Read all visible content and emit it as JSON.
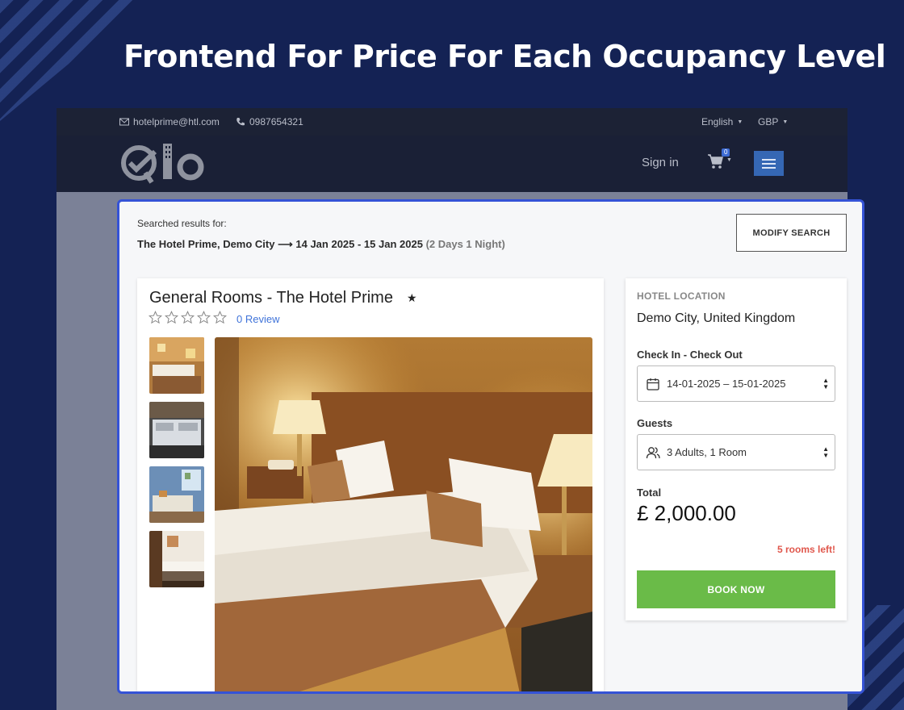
{
  "headline": "Frontend For Price For Each Occupancy Level",
  "topbar": {
    "email": "hotelprime@htl.com",
    "phone": "0987654321",
    "language": "English",
    "currency": "GBP"
  },
  "navbar": {
    "logo_text": "Qlo",
    "signin": "Sign in",
    "cart_count": "0"
  },
  "search": {
    "label": "Searched results for:",
    "hotel": "The Hotel Prime, Demo City",
    "arrow": "⟶",
    "dates": "14 Jan 2025 - 15 Jan 2025",
    "nights": "(2 Days 1 Night)",
    "modify_label": "MODIFY SEARCH"
  },
  "room": {
    "title": "General Rooms  - The Hotel Prime",
    "star_glyph": "★",
    "rating_stars": 0,
    "review_link": "0 Review"
  },
  "booking": {
    "location_label": "HOTEL LOCATION",
    "location": "Demo City, United Kingdom",
    "dates_label": "Check In - Check Out",
    "dates_value": "14-01-2025  –  15-01-2025",
    "guests_label": "Guests",
    "guests_value": "3 Adults, 1 Room",
    "total_label": "Total",
    "total_value": "£ 2,000.00",
    "rooms_left": "5 rooms left!",
    "book_label": "BOOK NOW"
  },
  "colors": {
    "background": "#142254",
    "panel_border": "#3553d6",
    "book_button": "#6abb48",
    "rooms_left": "#e0574c",
    "link": "#3f73d9"
  }
}
